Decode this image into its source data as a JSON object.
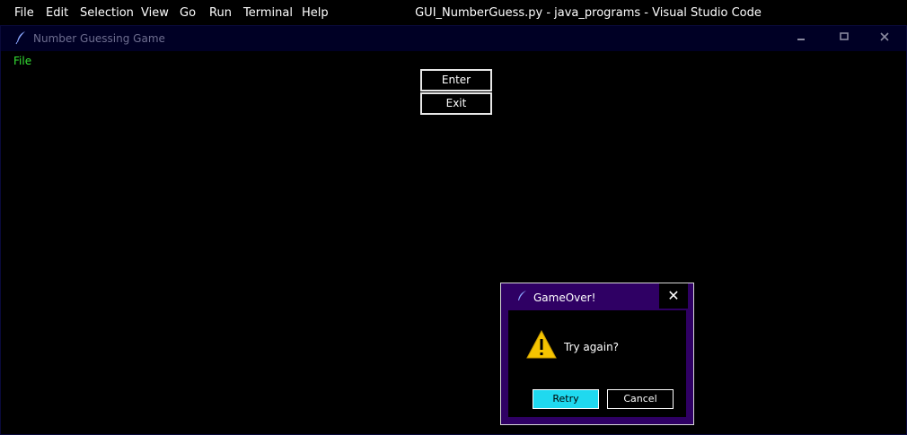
{
  "vscode": {
    "menu": [
      "File",
      "Edit",
      "Selection",
      "View",
      "Go",
      "Run",
      "Terminal",
      "Help"
    ],
    "title": "GUI_NumberGuess.py - java_programs - Visual Studio Code"
  },
  "app_window": {
    "title": "Number Guessing Game",
    "icon": "feather-icon",
    "controls": [
      "minimize-icon",
      "maximize-icon",
      "close-icon"
    ],
    "menu_file": "File",
    "enter_label": "Enter",
    "exit_label": "Exit",
    "accent_color": "#34e034"
  },
  "dialog": {
    "title": "GameOver!",
    "icon": "warning-icon",
    "message": "Try again?",
    "retry_label": "Retry",
    "cancel_label": "Cancel",
    "close_glyph": "✕",
    "retry_color": "#1fd9ef",
    "frame_color": "#2f0064"
  }
}
